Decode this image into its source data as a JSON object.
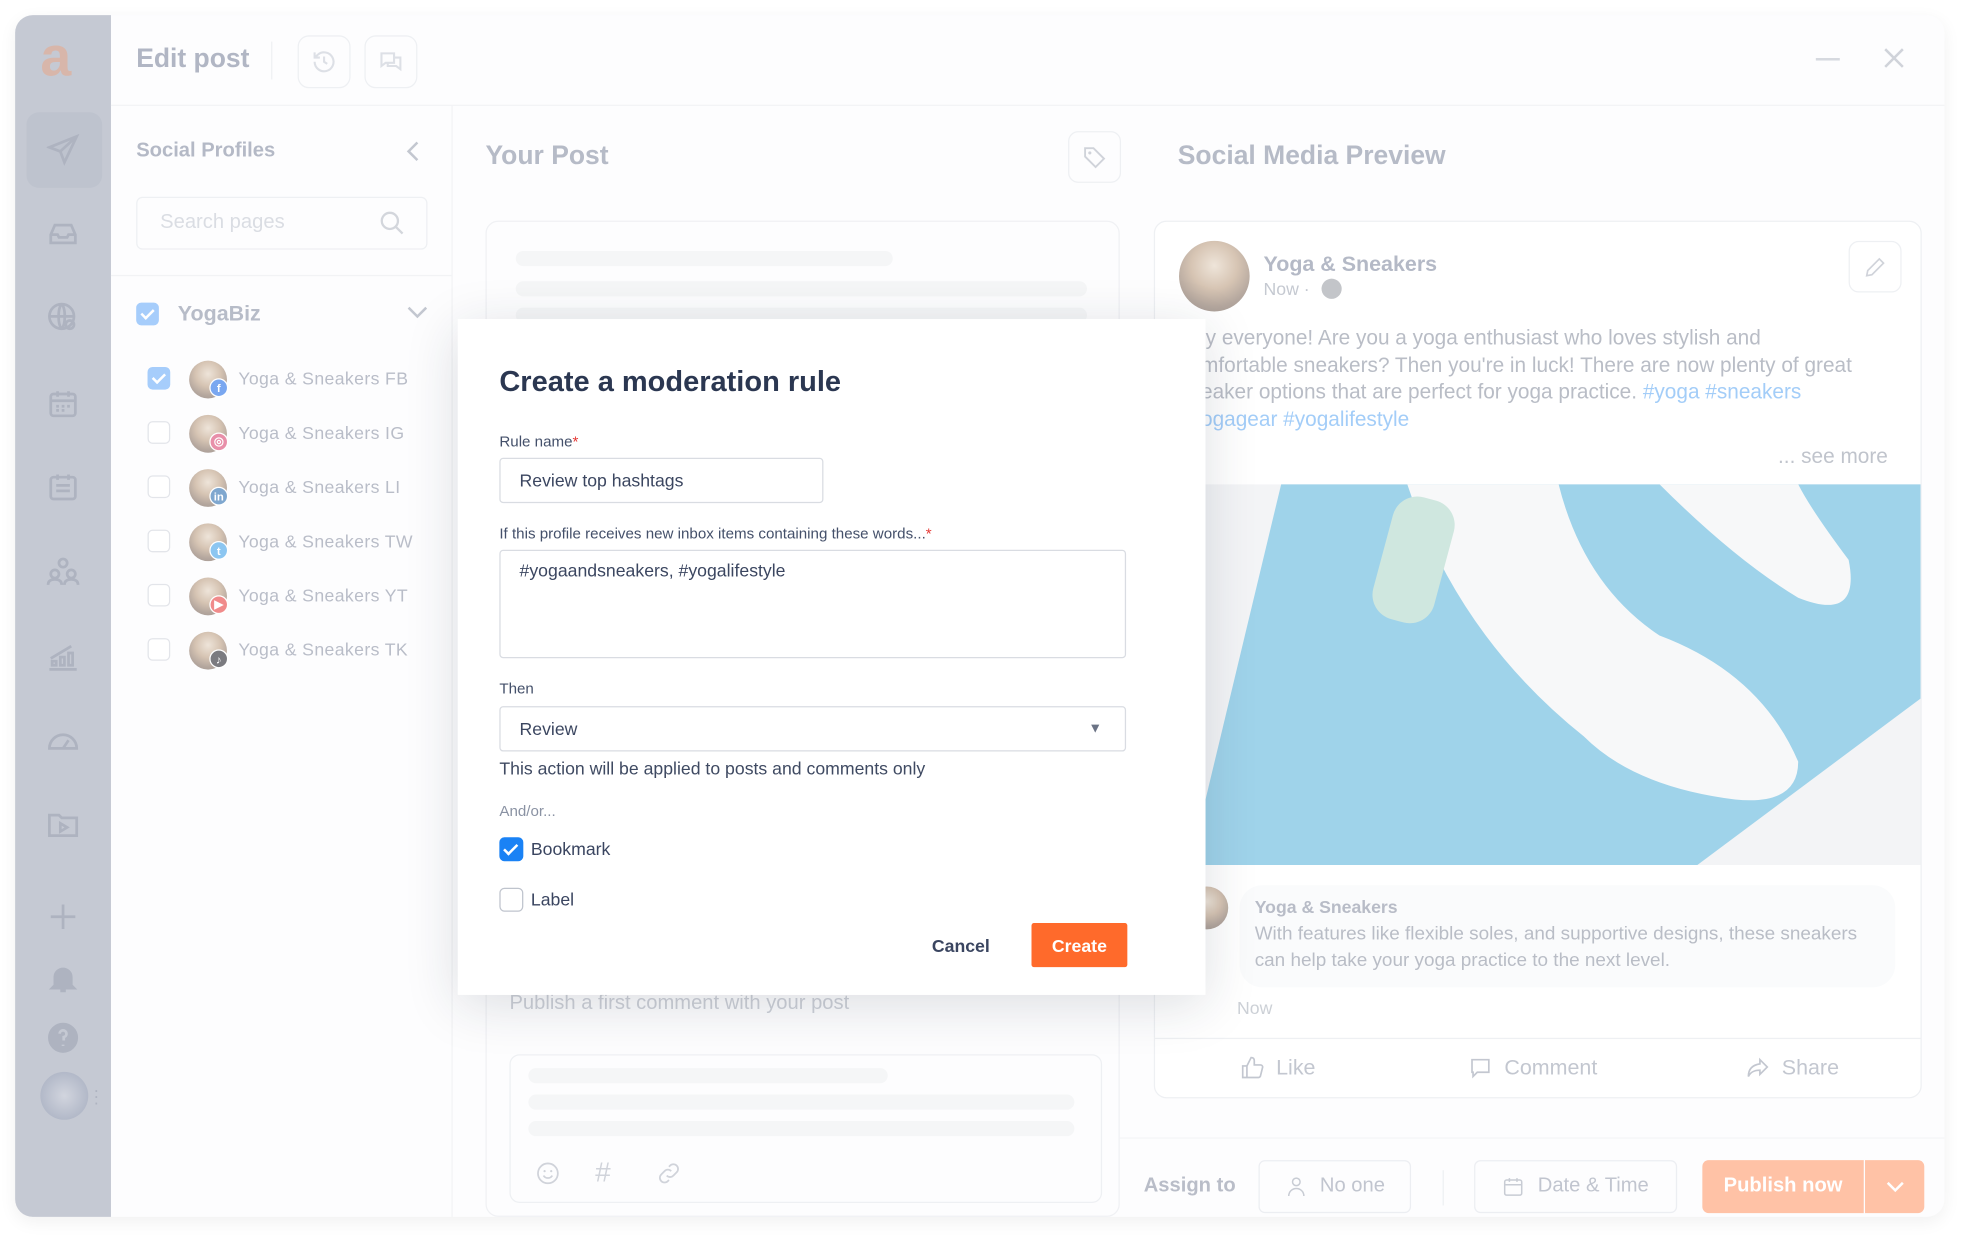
{
  "header": {
    "title": "Edit post",
    "history_icon": "history-icon",
    "comments_icon": "chat-icon",
    "minimize_icon": "minimize-icon",
    "close_icon": "close-icon"
  },
  "rail": {
    "logo": "a",
    "items": [
      "send-icon",
      "inbox-icon",
      "globe-search-icon",
      "calendar-icon",
      "schedule-icon",
      "team-icon",
      "analytics-icon",
      "dashboard-icon",
      "media-library-icon",
      "add-icon",
      "bell-icon",
      "help-icon",
      "avatar"
    ]
  },
  "profiles": {
    "title": "Social Profiles",
    "search_placeholder": "Search pages",
    "group": {
      "name": "YogaBiz",
      "checked": true
    },
    "items": [
      {
        "name": "Yoga & Sneakers FB",
        "network": "facebook",
        "checked": true,
        "color": "#7aa7f0"
      },
      {
        "name": "Yoga & Sneakers IG",
        "network": "instagram",
        "checked": false,
        "color": "#e88fa9"
      },
      {
        "name": "Yoga & Sneakers LI",
        "network": "linkedin",
        "checked": false,
        "color": "#7fa7cf"
      },
      {
        "name": "Yoga & Sneakers TW",
        "network": "twitter",
        "checked": false,
        "color": "#8cc6f1"
      },
      {
        "name": "Yoga & Sneakers YT",
        "network": "youtube",
        "checked": false,
        "color": "#f08b8b"
      },
      {
        "name": "Yoga & Sneakers TK",
        "network": "tiktok",
        "checked": false,
        "color": "#7b7b80"
      }
    ]
  },
  "post": {
    "title": "Your Post",
    "first_comment_placeholder": "Publish a first comment with your post"
  },
  "preview": {
    "title": "Social Media Preview",
    "page_name": "Yoga & Sneakers",
    "time": "Now ·",
    "text": "Hey everyone! Are you a yoga enthusiast who loves stylish and comfortable sneakers? Then you're in luck! There are now plenty of great sneaker options that are perfect for yoga practice. ",
    "hashtags": "#yoga #sneakers #yogagear #yogalifestyle",
    "see_more": "... see more",
    "comment": {
      "author": "Yoga & Sneakers",
      "text": "With features like flexible soles, and supportive designs, these sneakers can help take your yoga practice to the next level.",
      "time": "Now"
    },
    "actions": {
      "like": "Like",
      "comment": "Comment",
      "share": "Share"
    }
  },
  "footer": {
    "assign_label": "Assign to",
    "assignee": "No one",
    "datetime": "Date & Time",
    "publish": "Publish now",
    "accent": "#ffc2a6"
  },
  "modal": {
    "title": "Create a moderation rule",
    "rule_name_label": "Rule name",
    "rule_name_value": "Review top hashtags",
    "words_label": "If this profile receives new inbox items containing these words...",
    "words_value": "#yogaandsneakers, #yogalifestyle",
    "then_label": "Then",
    "then_value": "Review",
    "then_help": "This action will be applied to posts and comments only",
    "andor_label": "And/or...",
    "options": [
      {
        "label": "Bookmark",
        "checked": true
      },
      {
        "label": "Label",
        "checked": false
      }
    ],
    "required_mark": "*",
    "cancel": "Cancel",
    "create": "Create",
    "accent": "#ff6a2b",
    "checkbox_color": "#1a82f5"
  }
}
